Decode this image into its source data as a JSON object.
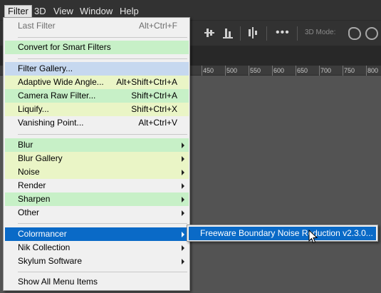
{
  "menubar": {
    "items": [
      {
        "label": "Filter",
        "active": true
      },
      {
        "label": "3D"
      },
      {
        "label": "View"
      },
      {
        "label": "Window"
      },
      {
        "label": "Help"
      }
    ]
  },
  "optionsbar": {
    "mode_label": "3D Mode:",
    "more_label": "•••"
  },
  "ruler": {
    "ticks": [
      "450",
      "500",
      "550",
      "600",
      "650",
      "700",
      "750",
      "800"
    ]
  },
  "menu": {
    "last_filter": {
      "label": "Last Filter",
      "shortcut": "Alt+Ctrl+F"
    },
    "convert": {
      "label": "Convert for Smart Filters"
    },
    "filter_gallery": {
      "label": "Filter Gallery..."
    },
    "adaptive": {
      "label": "Adaptive Wide Angle...",
      "shortcut": "Alt+Shift+Ctrl+A"
    },
    "camera_raw": {
      "label": "Camera Raw Filter...",
      "shortcut": "Shift+Ctrl+A"
    },
    "liquify": {
      "label": "Liquify...",
      "shortcut": "Shift+Ctrl+X"
    },
    "vanishing": {
      "label": "Vanishing Point...",
      "shortcut": "Alt+Ctrl+V"
    },
    "blur": {
      "label": "Blur"
    },
    "blur_gallery": {
      "label": "Blur Gallery"
    },
    "noise": {
      "label": "Noise"
    },
    "render": {
      "label": "Render"
    },
    "sharpen": {
      "label": "Sharpen"
    },
    "other": {
      "label": "Other"
    },
    "colormancer": {
      "label": "Colormancer"
    },
    "nik": {
      "label": "Nik Collection"
    },
    "skylum": {
      "label": "Skylum Software"
    },
    "show_all": {
      "label": "Show All Menu Items"
    }
  },
  "submenu": {
    "item": {
      "label": "Freeware Boundary Noise Reduction v2.3.0..."
    }
  },
  "colors": {
    "menubar_bg": "#323232",
    "menu_bg": "#f0f0f0",
    "selection": "#0a6ac7",
    "green_highlight": "#c7f0c7",
    "yellow_highlight": "#eaf5c6",
    "blue_highlight": "#c6d8ef"
  }
}
